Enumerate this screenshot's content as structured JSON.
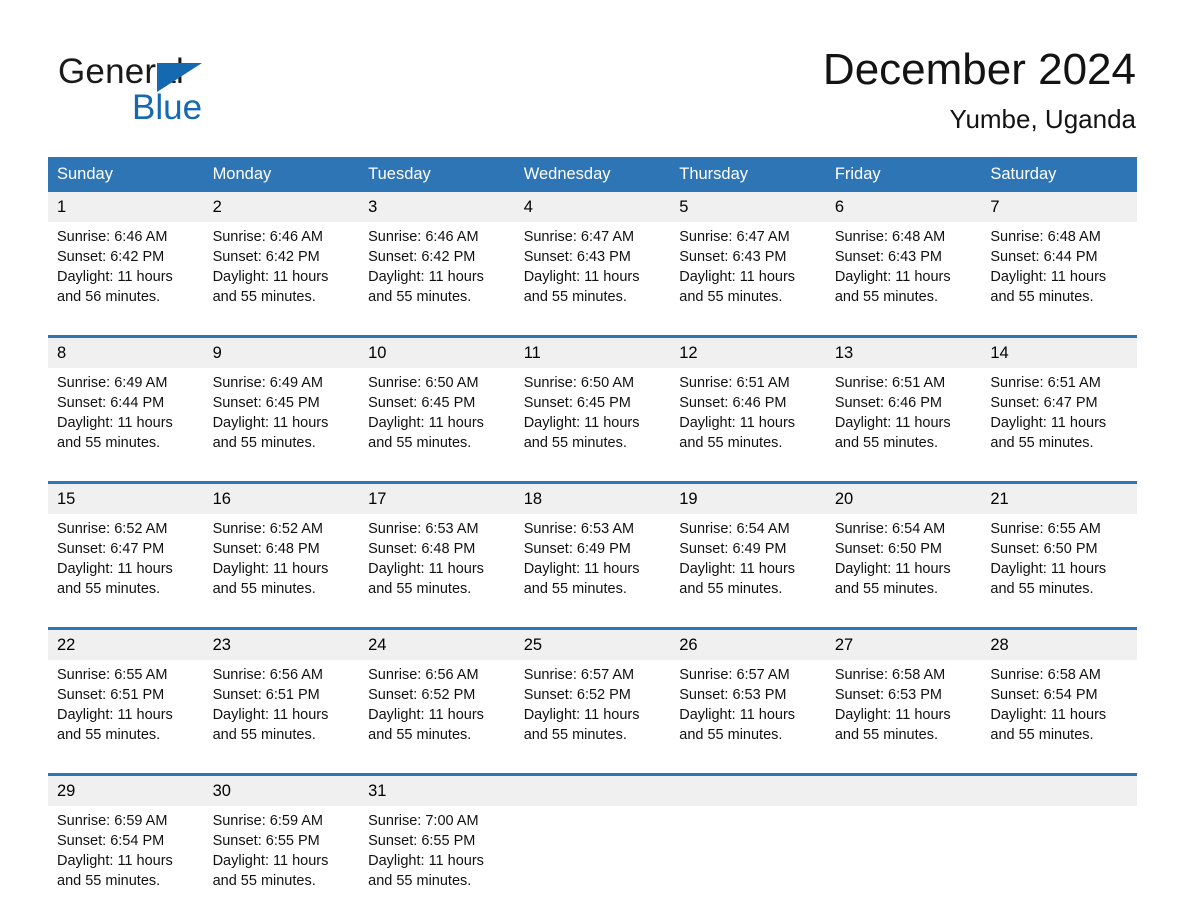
{
  "brand": {
    "word_one": "General",
    "word_two": "Blue",
    "triangle_icon": "triangle-icon",
    "accent_color": "#1569b0"
  },
  "header": {
    "month_title": "December 2024",
    "location": "Yumbe, Uganda"
  },
  "colors": {
    "header_blue": "#2e75b6",
    "row_band": "#f0f0f0",
    "text": "#111111"
  },
  "calendar": {
    "weekday_headers": [
      "Sunday",
      "Monday",
      "Tuesday",
      "Wednesday",
      "Thursday",
      "Friday",
      "Saturday"
    ],
    "weeks": [
      [
        {
          "day": "1",
          "sunrise": "Sunrise: 6:46 AM",
          "sunset": "Sunset: 6:42 PM",
          "daylight_1": "Daylight: 11 hours",
          "daylight_2": "and 56 minutes."
        },
        {
          "day": "2",
          "sunrise": "Sunrise: 6:46 AM",
          "sunset": "Sunset: 6:42 PM",
          "daylight_1": "Daylight: 11 hours",
          "daylight_2": "and 55 minutes."
        },
        {
          "day": "3",
          "sunrise": "Sunrise: 6:46 AM",
          "sunset": "Sunset: 6:42 PM",
          "daylight_1": "Daylight: 11 hours",
          "daylight_2": "and 55 minutes."
        },
        {
          "day": "4",
          "sunrise": "Sunrise: 6:47 AM",
          "sunset": "Sunset: 6:43 PM",
          "daylight_1": "Daylight: 11 hours",
          "daylight_2": "and 55 minutes."
        },
        {
          "day": "5",
          "sunrise": "Sunrise: 6:47 AM",
          "sunset": "Sunset: 6:43 PM",
          "daylight_1": "Daylight: 11 hours",
          "daylight_2": "and 55 minutes."
        },
        {
          "day": "6",
          "sunrise": "Sunrise: 6:48 AM",
          "sunset": "Sunset: 6:43 PM",
          "daylight_1": "Daylight: 11 hours",
          "daylight_2": "and 55 minutes."
        },
        {
          "day": "7",
          "sunrise": "Sunrise: 6:48 AM",
          "sunset": "Sunset: 6:44 PM",
          "daylight_1": "Daylight: 11 hours",
          "daylight_2": "and 55 minutes."
        }
      ],
      [
        {
          "day": "8",
          "sunrise": "Sunrise: 6:49 AM",
          "sunset": "Sunset: 6:44 PM",
          "daylight_1": "Daylight: 11 hours",
          "daylight_2": "and 55 minutes."
        },
        {
          "day": "9",
          "sunrise": "Sunrise: 6:49 AM",
          "sunset": "Sunset: 6:45 PM",
          "daylight_1": "Daylight: 11 hours",
          "daylight_2": "and 55 minutes."
        },
        {
          "day": "10",
          "sunrise": "Sunrise: 6:50 AM",
          "sunset": "Sunset: 6:45 PM",
          "daylight_1": "Daylight: 11 hours",
          "daylight_2": "and 55 minutes."
        },
        {
          "day": "11",
          "sunrise": "Sunrise: 6:50 AM",
          "sunset": "Sunset: 6:45 PM",
          "daylight_1": "Daylight: 11 hours",
          "daylight_2": "and 55 minutes."
        },
        {
          "day": "12",
          "sunrise": "Sunrise: 6:51 AM",
          "sunset": "Sunset: 6:46 PM",
          "daylight_1": "Daylight: 11 hours",
          "daylight_2": "and 55 minutes."
        },
        {
          "day": "13",
          "sunrise": "Sunrise: 6:51 AM",
          "sunset": "Sunset: 6:46 PM",
          "daylight_1": "Daylight: 11 hours",
          "daylight_2": "and 55 minutes."
        },
        {
          "day": "14",
          "sunrise": "Sunrise: 6:51 AM",
          "sunset": "Sunset: 6:47 PM",
          "daylight_1": "Daylight: 11 hours",
          "daylight_2": "and 55 minutes."
        }
      ],
      [
        {
          "day": "15",
          "sunrise": "Sunrise: 6:52 AM",
          "sunset": "Sunset: 6:47 PM",
          "daylight_1": "Daylight: 11 hours",
          "daylight_2": "and 55 minutes."
        },
        {
          "day": "16",
          "sunrise": "Sunrise: 6:52 AM",
          "sunset": "Sunset: 6:48 PM",
          "daylight_1": "Daylight: 11 hours",
          "daylight_2": "and 55 minutes."
        },
        {
          "day": "17",
          "sunrise": "Sunrise: 6:53 AM",
          "sunset": "Sunset: 6:48 PM",
          "daylight_1": "Daylight: 11 hours",
          "daylight_2": "and 55 minutes."
        },
        {
          "day": "18",
          "sunrise": "Sunrise: 6:53 AM",
          "sunset": "Sunset: 6:49 PM",
          "daylight_1": "Daylight: 11 hours",
          "daylight_2": "and 55 minutes."
        },
        {
          "day": "19",
          "sunrise": "Sunrise: 6:54 AM",
          "sunset": "Sunset: 6:49 PM",
          "daylight_1": "Daylight: 11 hours",
          "daylight_2": "and 55 minutes."
        },
        {
          "day": "20",
          "sunrise": "Sunrise: 6:54 AM",
          "sunset": "Sunset: 6:50 PM",
          "daylight_1": "Daylight: 11 hours",
          "daylight_2": "and 55 minutes."
        },
        {
          "day": "21",
          "sunrise": "Sunrise: 6:55 AM",
          "sunset": "Sunset: 6:50 PM",
          "daylight_1": "Daylight: 11 hours",
          "daylight_2": "and 55 minutes."
        }
      ],
      [
        {
          "day": "22",
          "sunrise": "Sunrise: 6:55 AM",
          "sunset": "Sunset: 6:51 PM",
          "daylight_1": "Daylight: 11 hours",
          "daylight_2": "and 55 minutes."
        },
        {
          "day": "23",
          "sunrise": "Sunrise: 6:56 AM",
          "sunset": "Sunset: 6:51 PM",
          "daylight_1": "Daylight: 11 hours",
          "daylight_2": "and 55 minutes."
        },
        {
          "day": "24",
          "sunrise": "Sunrise: 6:56 AM",
          "sunset": "Sunset: 6:52 PM",
          "daylight_1": "Daylight: 11 hours",
          "daylight_2": "and 55 minutes."
        },
        {
          "day": "25",
          "sunrise": "Sunrise: 6:57 AM",
          "sunset": "Sunset: 6:52 PM",
          "daylight_1": "Daylight: 11 hours",
          "daylight_2": "and 55 minutes."
        },
        {
          "day": "26",
          "sunrise": "Sunrise: 6:57 AM",
          "sunset": "Sunset: 6:53 PM",
          "daylight_1": "Daylight: 11 hours",
          "daylight_2": "and 55 minutes."
        },
        {
          "day": "27",
          "sunrise": "Sunrise: 6:58 AM",
          "sunset": "Sunset: 6:53 PM",
          "daylight_1": "Daylight: 11 hours",
          "daylight_2": "and 55 minutes."
        },
        {
          "day": "28",
          "sunrise": "Sunrise: 6:58 AM",
          "sunset": "Sunset: 6:54 PM",
          "daylight_1": "Daylight: 11 hours",
          "daylight_2": "and 55 minutes."
        }
      ],
      [
        {
          "day": "29",
          "sunrise": "Sunrise: 6:59 AM",
          "sunset": "Sunset: 6:54 PM",
          "daylight_1": "Daylight: 11 hours",
          "daylight_2": "and 55 minutes."
        },
        {
          "day": "30",
          "sunrise": "Sunrise: 6:59 AM",
          "sunset": "Sunset: 6:55 PM",
          "daylight_1": "Daylight: 11 hours",
          "daylight_2": "and 55 minutes."
        },
        {
          "day": "31",
          "sunrise": "Sunrise: 7:00 AM",
          "sunset": "Sunset: 6:55 PM",
          "daylight_1": "Daylight: 11 hours",
          "daylight_2": "and 55 minutes."
        },
        {
          "day": "",
          "sunrise": "",
          "sunset": "",
          "daylight_1": "",
          "daylight_2": ""
        },
        {
          "day": "",
          "sunrise": "",
          "sunset": "",
          "daylight_1": "",
          "daylight_2": ""
        },
        {
          "day": "",
          "sunrise": "",
          "sunset": "",
          "daylight_1": "",
          "daylight_2": ""
        },
        {
          "day": "",
          "sunrise": "",
          "sunset": "",
          "daylight_1": "",
          "daylight_2": ""
        }
      ]
    ]
  }
}
